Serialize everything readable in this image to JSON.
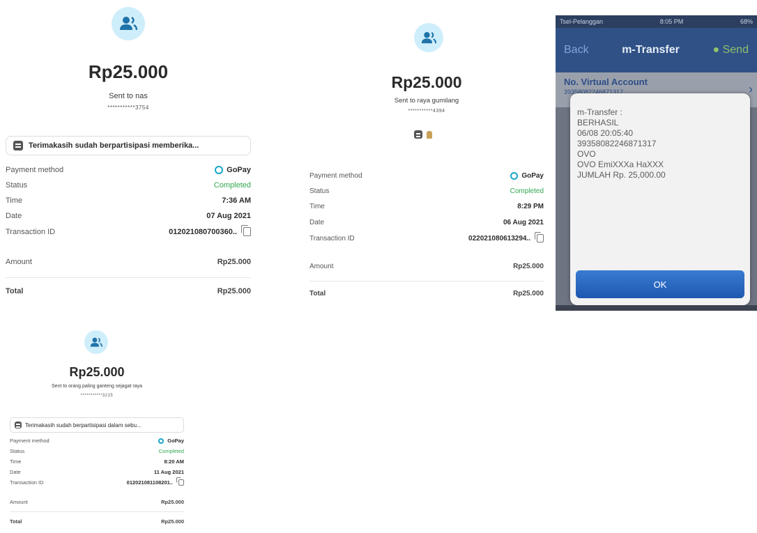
{
  "receipts": [
    {
      "amount": "Rp25.000",
      "sent": "Sent to nas",
      "account": "***********3754",
      "note": "Terimakasih sudah berpartisipasi memberika...",
      "rows": [
        {
          "label": "Payment method",
          "value": "GoPay"
        },
        {
          "label": "Status",
          "value": "Completed"
        },
        {
          "label": "Time",
          "value": "7:36 AM"
        },
        {
          "label": "Date",
          "value": "07 Aug 2021"
        },
        {
          "label": "Transaction ID",
          "value": "012021080700360.."
        }
      ],
      "amount_label": "Amount",
      "amount_value": "Rp25.000",
      "total_label": "Total",
      "total_value": "Rp25.000"
    },
    {
      "amount": "Rp25.000",
      "sent": "Sent to raya gumilang",
      "account": "***********4394",
      "rows": [
        {
          "label": "Payment method",
          "value": "GoPay"
        },
        {
          "label": "Status",
          "value": "Completed"
        },
        {
          "label": "Time",
          "value": "8:29 PM"
        },
        {
          "label": "Date",
          "value": "06 Aug 2021"
        },
        {
          "label": "Transaction ID",
          "value": "022021080613294.."
        }
      ],
      "amount_label": "Amount",
      "amount_value": "Rp25.000",
      "total_label": "Total",
      "total_value": "Rp25.000"
    },
    {
      "amount": "Rp25.000",
      "sent": "Sent to orang paling ganteng sejagat raya",
      "account": "***********3215",
      "note": "Terimakasih sudah berpartisipasi dalam sebu...",
      "rows": [
        {
          "label": "Payment method",
          "value": "GoPay"
        },
        {
          "label": "Status",
          "value": "Completed"
        },
        {
          "label": "Time",
          "value": "8:20 AM"
        },
        {
          "label": "Date",
          "value": "11 Aug 2021"
        },
        {
          "label": "Transaction ID",
          "value": "012021081108201.."
        }
      ],
      "amount_label": "Amount",
      "amount_value": "Rp25.000",
      "total_label": "Total",
      "total_value": "Rp25.000"
    }
  ],
  "phone": {
    "carrier": "Tsel-Pelanggan",
    "time": "8:05 PM",
    "battery": "68%",
    "nav_back": "Back",
    "nav_title": "m-Transfer",
    "nav_send": "Send",
    "va_title": "No. Virtual Account",
    "va_number": "39358082246871317",
    "alert_lines": [
      "m-Transfer :",
      "BERHASIL",
      "06/08 20:05:40",
      "39358082246871317",
      "OVO",
      "OVO EmiXXXa HaXXX",
      "JUMLAH Rp. 25,000.00"
    ],
    "ok_label": "OK"
  },
  "colors": {
    "avatar_bg": "#cfeefb",
    "avatar_icon": "#1f73a8",
    "status_green": "#2fa84f",
    "gopay_blue": "#1aa5c8",
    "phone_nav": "#2f5186",
    "ok_button": "#1d58b0"
  },
  "icons": [
    "user-group-icon",
    "note-icon",
    "gopay-icon",
    "copy-icon",
    "chevron-right-icon"
  ]
}
